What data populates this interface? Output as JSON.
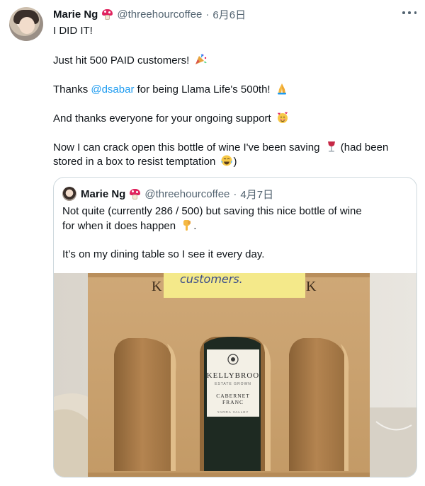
{
  "tweet": {
    "author_name": "Marie Ng",
    "author_handle": "@threehourcoffee",
    "separator": "·",
    "date": "6月6日",
    "line1": "I DID IT!",
    "line2": "Just hit 500 PAID customers!",
    "line3_prefix": "Thanks ",
    "line3_mention": "@dsabar",
    "line3_suffix": " for being Llama Life's 500th!",
    "line4": "And thanks everyone for your ongoing support",
    "line5a": "Now I can crack open this bottle of wine I've been saving",
    "line5b": " (had been",
    "line6": "stored in a box to resist temptation",
    "line6_end": ")"
  },
  "quoted": {
    "author_name": "Marie Ng",
    "author_handle": "@threehourcoffee",
    "separator": "·",
    "date": "4月7日",
    "line1": "Not quite (currently 286 / 500) but saving this nice bottle of wine",
    "line2": "for when it does happen",
    "line2_end": ".",
    "line3": "It’s on my dining table so I see it every day."
  },
  "photo": {
    "sticky_note_text": "customers.",
    "box_print_left": "K",
    "box_print_right": "K",
    "label_brand": "KELLYBROO",
    "label_sub": "ESTATE GROWN",
    "label_variety1": "CABERNET",
    "label_variety2": "FRANC",
    "label_region": "YARRA VALLEY"
  },
  "icons": {
    "emoji_party": "party-popper",
    "emoji_pray": "folded-hands",
    "emoji_hearts": "smiling-face-with-hearts",
    "emoji_wine": "wine-glass",
    "emoji_laugh": "face-with-tears-of-joy",
    "emoji_point": "pointing-down",
    "badge": "mushroom"
  },
  "colors": {
    "text": "#0f1419",
    "secondary": "#536471",
    "link": "#1d9bf0",
    "border": "#cfd9de"
  }
}
